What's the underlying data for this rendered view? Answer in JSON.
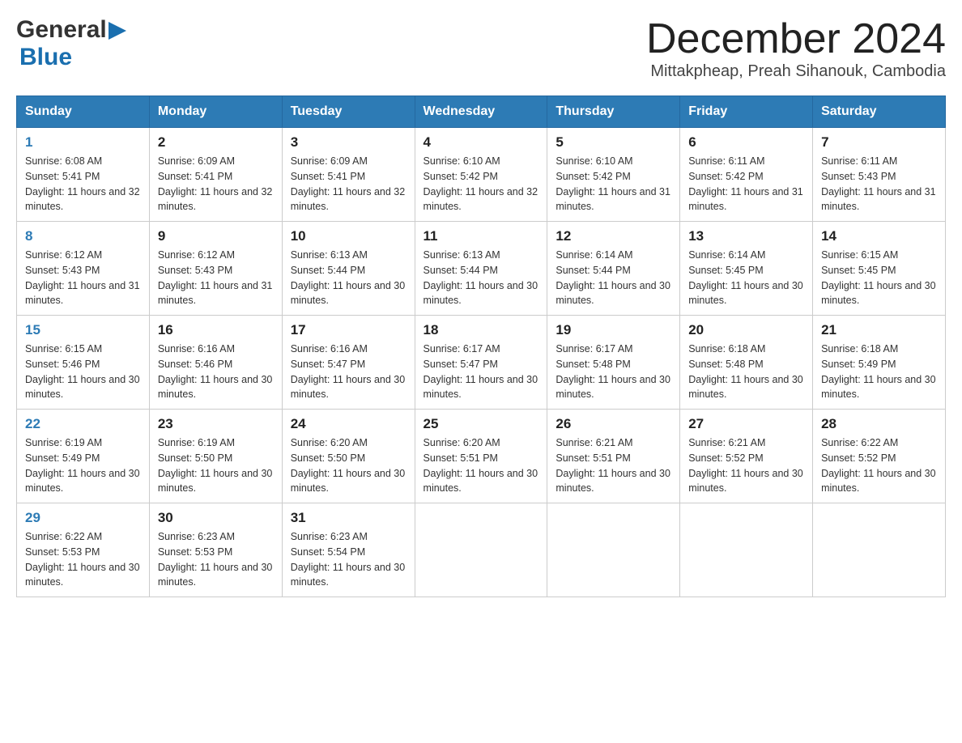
{
  "logo": {
    "general": "General",
    "blue": "Blue"
  },
  "title": "December 2024",
  "location": "Mittakpheap, Preah Sihanouk, Cambodia",
  "days_of_week": [
    "Sunday",
    "Monday",
    "Tuesday",
    "Wednesday",
    "Thursday",
    "Friday",
    "Saturday"
  ],
  "weeks": [
    [
      {
        "day": "1",
        "sunrise": "6:08 AM",
        "sunset": "5:41 PM",
        "daylight": "11 hours and 32 minutes."
      },
      {
        "day": "2",
        "sunrise": "6:09 AM",
        "sunset": "5:41 PM",
        "daylight": "11 hours and 32 minutes."
      },
      {
        "day": "3",
        "sunrise": "6:09 AM",
        "sunset": "5:41 PM",
        "daylight": "11 hours and 32 minutes."
      },
      {
        "day": "4",
        "sunrise": "6:10 AM",
        "sunset": "5:42 PM",
        "daylight": "11 hours and 32 minutes."
      },
      {
        "day": "5",
        "sunrise": "6:10 AM",
        "sunset": "5:42 PM",
        "daylight": "11 hours and 31 minutes."
      },
      {
        "day": "6",
        "sunrise": "6:11 AM",
        "sunset": "5:42 PM",
        "daylight": "11 hours and 31 minutes."
      },
      {
        "day": "7",
        "sunrise": "6:11 AM",
        "sunset": "5:43 PM",
        "daylight": "11 hours and 31 minutes."
      }
    ],
    [
      {
        "day": "8",
        "sunrise": "6:12 AM",
        "sunset": "5:43 PM",
        "daylight": "11 hours and 31 minutes."
      },
      {
        "day": "9",
        "sunrise": "6:12 AM",
        "sunset": "5:43 PM",
        "daylight": "11 hours and 31 minutes."
      },
      {
        "day": "10",
        "sunrise": "6:13 AM",
        "sunset": "5:44 PM",
        "daylight": "11 hours and 30 minutes."
      },
      {
        "day": "11",
        "sunrise": "6:13 AM",
        "sunset": "5:44 PM",
        "daylight": "11 hours and 30 minutes."
      },
      {
        "day": "12",
        "sunrise": "6:14 AM",
        "sunset": "5:44 PM",
        "daylight": "11 hours and 30 minutes."
      },
      {
        "day": "13",
        "sunrise": "6:14 AM",
        "sunset": "5:45 PM",
        "daylight": "11 hours and 30 minutes."
      },
      {
        "day": "14",
        "sunrise": "6:15 AM",
        "sunset": "5:45 PM",
        "daylight": "11 hours and 30 minutes."
      }
    ],
    [
      {
        "day": "15",
        "sunrise": "6:15 AM",
        "sunset": "5:46 PM",
        "daylight": "11 hours and 30 minutes."
      },
      {
        "day": "16",
        "sunrise": "6:16 AM",
        "sunset": "5:46 PM",
        "daylight": "11 hours and 30 minutes."
      },
      {
        "day": "17",
        "sunrise": "6:16 AM",
        "sunset": "5:47 PM",
        "daylight": "11 hours and 30 minutes."
      },
      {
        "day": "18",
        "sunrise": "6:17 AM",
        "sunset": "5:47 PM",
        "daylight": "11 hours and 30 minutes."
      },
      {
        "day": "19",
        "sunrise": "6:17 AM",
        "sunset": "5:48 PM",
        "daylight": "11 hours and 30 minutes."
      },
      {
        "day": "20",
        "sunrise": "6:18 AM",
        "sunset": "5:48 PM",
        "daylight": "11 hours and 30 minutes."
      },
      {
        "day": "21",
        "sunrise": "6:18 AM",
        "sunset": "5:49 PM",
        "daylight": "11 hours and 30 minutes."
      }
    ],
    [
      {
        "day": "22",
        "sunrise": "6:19 AM",
        "sunset": "5:49 PM",
        "daylight": "11 hours and 30 minutes."
      },
      {
        "day": "23",
        "sunrise": "6:19 AM",
        "sunset": "5:50 PM",
        "daylight": "11 hours and 30 minutes."
      },
      {
        "day": "24",
        "sunrise": "6:20 AM",
        "sunset": "5:50 PM",
        "daylight": "11 hours and 30 minutes."
      },
      {
        "day": "25",
        "sunrise": "6:20 AM",
        "sunset": "5:51 PM",
        "daylight": "11 hours and 30 minutes."
      },
      {
        "day": "26",
        "sunrise": "6:21 AM",
        "sunset": "5:51 PM",
        "daylight": "11 hours and 30 minutes."
      },
      {
        "day": "27",
        "sunrise": "6:21 AM",
        "sunset": "5:52 PM",
        "daylight": "11 hours and 30 minutes."
      },
      {
        "day": "28",
        "sunrise": "6:22 AM",
        "sunset": "5:52 PM",
        "daylight": "11 hours and 30 minutes."
      }
    ],
    [
      {
        "day": "29",
        "sunrise": "6:22 AM",
        "sunset": "5:53 PM",
        "daylight": "11 hours and 30 minutes."
      },
      {
        "day": "30",
        "sunrise": "6:23 AM",
        "sunset": "5:53 PM",
        "daylight": "11 hours and 30 minutes."
      },
      {
        "day": "31",
        "sunrise": "6:23 AM",
        "sunset": "5:54 PM",
        "daylight": "11 hours and 30 minutes."
      },
      null,
      null,
      null,
      null
    ]
  ]
}
